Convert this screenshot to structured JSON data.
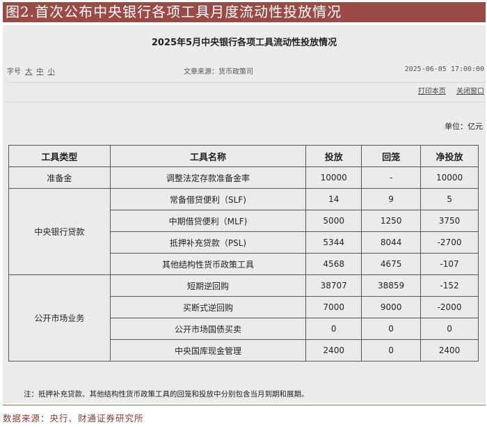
{
  "figure_title": "图2.首次公布中央银行各项工具月度流动性投放情况",
  "article": {
    "title": "2025年5月中央银行各项工具流动性投放情况",
    "font_size_label": "字号",
    "font_sizes": [
      "大",
      "中",
      "小"
    ],
    "source": "文章来源：货币政策司",
    "datetime": "2025-06-05 17:00:00",
    "print": "打印本页",
    "close": "关闭窗口",
    "unit": "单位：亿元"
  },
  "table": {
    "headers": [
      "工具类型",
      "工具名称",
      "投放",
      "回笼",
      "净投放"
    ],
    "groups": [
      {
        "type": "准备金",
        "rows": [
          [
            "调整法定存款准备金率",
            "10000",
            "-",
            "10000"
          ]
        ]
      },
      {
        "type": "中央银行贷款",
        "rows": [
          [
            "常备借贷便利（SLF)",
            "14",
            "9",
            "5"
          ],
          [
            "中期借贷便利（MLF)",
            "5000",
            "1250",
            "3750"
          ],
          [
            "抵押补充贷款（PSL)",
            "5344",
            "8044",
            "-2700"
          ],
          [
            "其他结构性货币政策工具",
            "4568",
            "4675",
            "-107"
          ]
        ]
      },
      {
        "type": "公开市场业务",
        "rows": [
          [
            "短期逆回购",
            "38707",
            "38859",
            "-152"
          ],
          [
            "买断式逆回购",
            "7000",
            "9000",
            "-2000"
          ],
          [
            "公开市场国债买卖",
            "0",
            "0",
            "0"
          ],
          [
            "中央国库现金管理",
            "2400",
            "0",
            "2400"
          ]
        ]
      }
    ]
  },
  "note": "注：抵押补充贷款、其他结构性货币政策工具的回笼和投放中分别包含当月到期和展期。",
  "data_source": "数据来源：央行、财通证券研究所"
}
